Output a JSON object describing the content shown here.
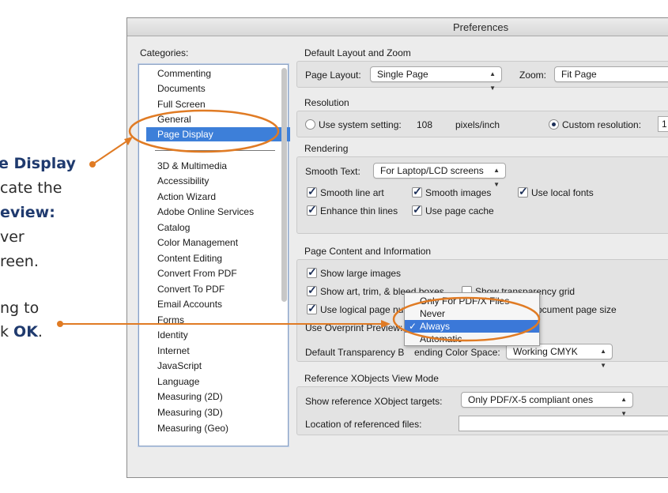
{
  "callout": {
    "line1": "e Display",
    "line2": "cate the",
    "line3": "eview:",
    "line4": "ver",
    "line5": "reen.",
    "line6a": "ng to",
    "line7a": "k ",
    "line7b": "OK",
    "line7c": ".",
    "color": "#e07b24"
  },
  "window": {
    "title": "Preferences"
  },
  "categories": {
    "label": "Categories:",
    "top_items": [
      "Commenting",
      "Documents",
      "Full Screen",
      "General",
      "Page Display"
    ],
    "items": [
      "3D & Multimedia",
      "Accessibility",
      "Action Wizard",
      "Adobe Online Services",
      "Catalog",
      "Color Management",
      "Content Editing",
      "Convert From PDF",
      "Convert To PDF",
      "Email Accounts",
      "Forms",
      "Identity",
      "Internet",
      "JavaScript",
      "Language",
      "Measuring (2D)",
      "Measuring (3D)",
      "Measuring (Geo)"
    ],
    "selected": "Page Display"
  },
  "layout_zoom": {
    "heading": "Default Layout and Zoom",
    "page_layout_label": "Page Layout:",
    "page_layout_value": "Single Page",
    "zoom_label": "Zoom:",
    "zoom_value": "Fit Page"
  },
  "resolution": {
    "heading": "Resolution",
    "system_label": "Use system setting:",
    "system_value": "108",
    "system_unit": "pixels/inch",
    "custom_label": "Custom resolution:",
    "custom_value": "1"
  },
  "rendering": {
    "heading": "Rendering",
    "smooth_text_label": "Smooth Text:",
    "smooth_text_value": "For Laptop/LCD screens",
    "smooth_line_art": "Smooth line art",
    "smooth_images": "Smooth images",
    "use_local_fonts": "Use local fonts",
    "enhance_thin_lines": "Enhance thin lines",
    "use_page_cache": "Use page cache"
  },
  "page_content": {
    "heading": "Page Content and Information",
    "show_large_images": "Show large images",
    "show_art_trim_bleed": "Show art, trim, & bleed boxes",
    "show_transparency_grid": "Show transparency grid",
    "use_logical_page_numbers": "Use logical page nu",
    "document_page_size": "ocument page size",
    "overprint_label": "Use Overprint Preview:",
    "overprint_options": [
      "Only For PDF/X Files",
      "Never",
      "Always",
      "Automatic"
    ],
    "overprint_selected": "Always",
    "blending_label_start": "Default Transparency B",
    "blending_label_end": "ending Color Space:",
    "blending_value": "Working CMYK"
  },
  "xobjects": {
    "heading": "Reference XObjects View Mode",
    "targets_label": "Show reference XObject targets:",
    "targets_value": "Only PDF/X-5 compliant ones",
    "location_label": "Location of referenced files:",
    "location_value": ""
  }
}
